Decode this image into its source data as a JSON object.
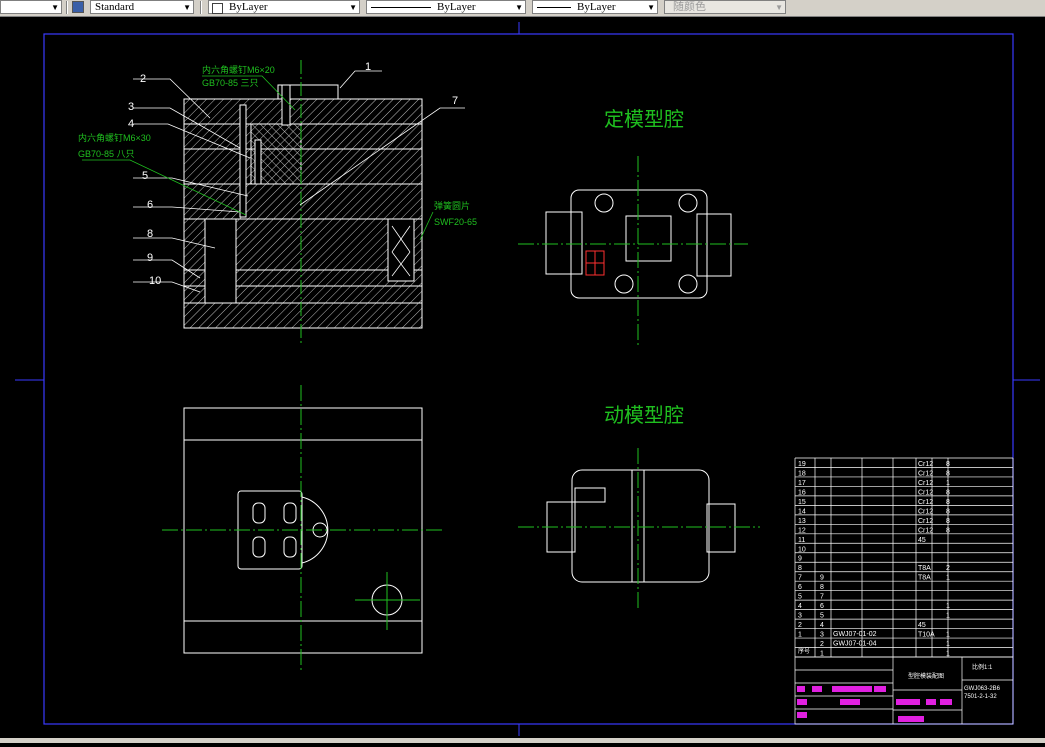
{
  "toolbar": {
    "textstyle_value": "Standard",
    "layer_value": "ByLayer",
    "linetype_value": "ByLayer",
    "lineweight_value": "ByLayer",
    "plotstyle_value": "随颜色"
  },
  "drawing": {
    "top_title": "定模型腔",
    "bottom_title": "动模型腔",
    "callouts": [
      "1",
      "2",
      "3",
      "4",
      "5",
      "6",
      "7",
      "8",
      "9",
      "10"
    ],
    "note_screw1_line1": "内六角螺钉M6×20",
    "note_screw1_line2": "GB70-85 三只",
    "note_screw2_line1": "内六角螺钉M6×30",
    "note_screw2_line2": "GB70-85 八只",
    "note_spring_line1": "弹簧圆片",
    "note_spring_line2": "SWF20-65"
  },
  "bom": {
    "seq_numbers": [
      "19",
      "18",
      "17",
      "16",
      "15",
      "14",
      "13",
      "12",
      "11",
      "10",
      "9",
      "8",
      "7",
      "6",
      "5",
      "4",
      "3",
      "2",
      "1"
    ],
    "part_numbers": [
      "",
      "",
      "",
      "",
      "",
      "",
      "",
      "",
      "",
      "",
      "",
      "",
      "9",
      "8",
      "7",
      "6",
      "5",
      "4",
      "3",
      "2",
      "1"
    ],
    "materials": [
      "Cr12",
      "Cr12",
      "Cr12",
      "Cr12",
      "Cr12",
      "Cr12",
      "Cr12",
      "Cr12",
      "45",
      "",
      "",
      "T8A",
      "T8A",
      "",
      "",
      "",
      "",
      "45",
      "T10A",
      "",
      ""
    ],
    "quantities": [
      "8",
      "8",
      "1",
      "8",
      "8",
      "8",
      "8",
      "8",
      "",
      "",
      "",
      "2",
      "1",
      "",
      "",
      "1",
      "1",
      "",
      "1",
      "1",
      "1"
    ],
    "codes": [
      "GWJ07-01-02",
      "GWJ07-01-04"
    ],
    "header_seq": "序号",
    "title_block_name": "型腔模装配图",
    "title_block_code": "GWJ063-2B6",
    "title_block_sub": "7501-2-1-32",
    "scale_label": "比例1:1"
  }
}
